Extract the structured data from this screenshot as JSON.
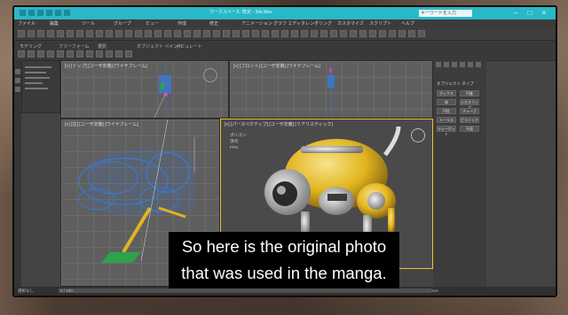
{
  "window": {
    "title": "ワークスペース: 既定 - 3ds Max",
    "search_placeholder": "キーワードを入力",
    "minimize": "–",
    "maximize": "□",
    "close": "×"
  },
  "menu": [
    "ファイル",
    "編集",
    "ツール",
    "グループ",
    "ビュー",
    "作成",
    "修正",
    "アニメーション",
    "グラフ エディタ",
    "レンダリング",
    "カスタマイズ",
    "スクリプト",
    "ヘルプ"
  ],
  "ribbon": {
    "tabs": [
      "モデリング",
      "フリーフォーム",
      "選択",
      "オブジェクト ペイント",
      "ポピュレート"
    ]
  },
  "viewports": {
    "top": "[+] [トップ] [ユーザ定義] [ワイヤフレーム]",
    "front": "[+] [フロント] [ユーザ定義] [ワイヤフレーム]",
    "left": "[+] [左] [ユーザ定義] [ワイヤフレーム]",
    "perspective": "[+] [パースペクティブ] [ユーザ定義] [リアリスティック]"
  },
  "stats": {
    "label_polys": "ポリゴン:",
    "label_verts": "頂点:",
    "label_fps": "FPS:"
  },
  "command_panel": {
    "header": "オブジェクト タイプ",
    "buttons": [
      "ボックス",
      "円錐",
      "球",
      "ジオスフィア",
      "円柱",
      "チューブ",
      "トーラス",
      "ピラミッド",
      "ティーポット",
      "平面"
    ]
  },
  "status": {
    "frame": "0 / 100",
    "left_text": "選択なし",
    "right_text": "グリッド = 10.0cm"
  },
  "subtitle": {
    "line1": "So here is the original photo",
    "line2": "that was used in the manga."
  },
  "colors": {
    "titlebar": "#29b8c8",
    "wireframe": "#3a78d6",
    "robot_body": "#e2b51f",
    "subtitle_bg": "#000000"
  }
}
